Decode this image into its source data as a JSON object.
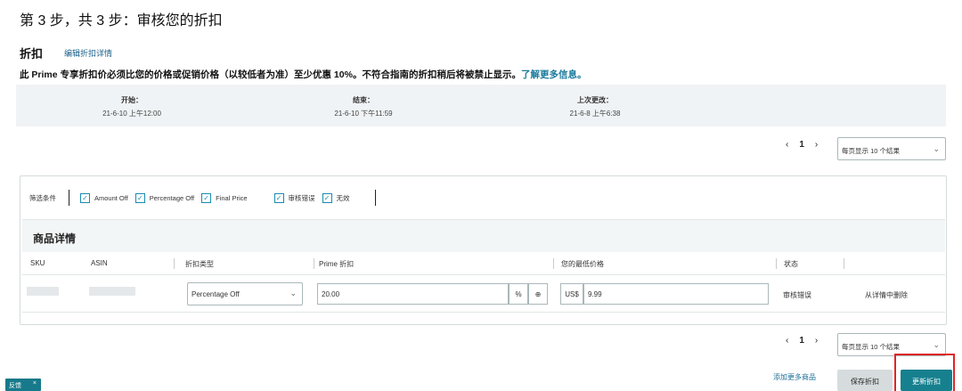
{
  "page": {
    "step_title": "第 3 步，共 3 步：审核您的折扣",
    "section_title": "折扣",
    "edit_link": "编辑折扣详情",
    "notice_text": "此 Prime 专享折扣价必须比您的价格或促销价格（以较低者为准）至少优惠 10%。不符合指南的折扣稍后将被禁止显示。",
    "notice_link": "了解更多信息。"
  },
  "dates": [
    {
      "label": "开始：",
      "value": "21-6-10 上午12:00"
    },
    {
      "label": "结束：",
      "value": "21-6-10 下午11:59"
    },
    {
      "label": "上次更改：",
      "value": "21-6-8 上午6:38"
    }
  ],
  "pager_top": {
    "prev": "‹",
    "page": "1",
    "next": "›",
    "per_page": "每页显示 10 个结果"
  },
  "pager_bottom": {
    "prev": "‹",
    "page": "1",
    "next": "›",
    "per_page": "每页显示 10 个结果"
  },
  "filters": {
    "label": "筛选条件",
    "items": [
      "Amount Off",
      "Percentage Off",
      "Final Price",
      "审核错误",
      "无效"
    ]
  },
  "products": {
    "title": "商品详情",
    "columns": [
      "SKU",
      "ASIN",
      "折扣类型",
      "Prime 折扣",
      "您的最低价格",
      "状态"
    ],
    "rows": [
      {
        "discount_type": "Percentage Off",
        "prime_discount": "20.00",
        "unit": "%",
        "currency": "US$",
        "min_price": "9.99",
        "status": "审核错误",
        "action": "从详情中删除"
      }
    ]
  },
  "buttons": {
    "add_more": "添加更多商品",
    "save": "保存折扣",
    "update": "更新折扣"
  },
  "feedback": {
    "label": "反馈",
    "close": "×"
  },
  "colors": {
    "accent": "#16808f",
    "highlight": "#e02525"
  }
}
